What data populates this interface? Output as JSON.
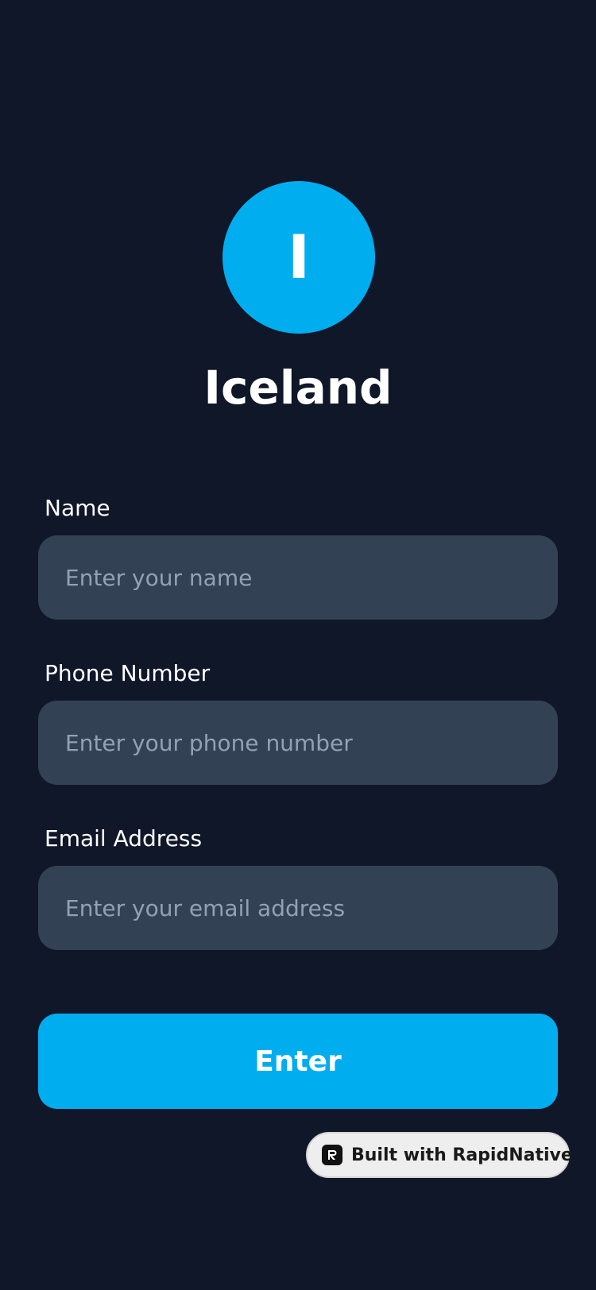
{
  "brand": {
    "avatar_letter": "I",
    "title": "Iceland"
  },
  "form": {
    "name": {
      "label": "Name",
      "placeholder": "Enter your name"
    },
    "phone": {
      "label": "Phone Number",
      "placeholder": "Enter your phone number"
    },
    "email": {
      "label": "Email Address",
      "placeholder": "Enter your email address"
    },
    "submit_label": "Enter"
  },
  "badge": {
    "text": "Built with RapidNative",
    "icon": "rapidnative-logo-icon"
  },
  "colors": {
    "background": "#0f1729",
    "accent": "#00adef",
    "input_background": "#334155",
    "placeholder": "#93a1b5",
    "badge_background": "#eeeeee"
  }
}
